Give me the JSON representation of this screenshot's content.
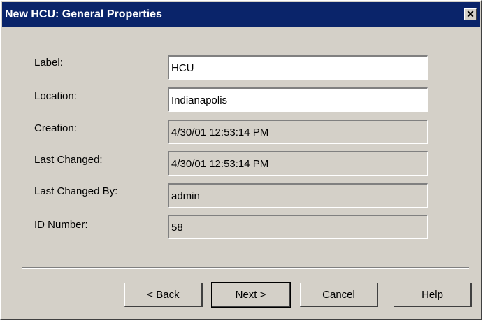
{
  "window": {
    "title": "New HCU: General Properties",
    "close_glyph": "✕"
  },
  "fields": [
    {
      "label": "Label:",
      "value": "HCU",
      "editable": true
    },
    {
      "label": "Location:",
      "value": "Indianapolis",
      "editable": true
    },
    {
      "label": "Creation:",
      "value": "4/30/01 12:53:14 PM",
      "editable": false
    },
    {
      "label": "Last Changed:",
      "value": "4/30/01 12:53:14 PM",
      "editable": false
    },
    {
      "label": "Last Changed By:",
      "value": "admin",
      "editable": false
    },
    {
      "label": "ID Number:",
      "value": "58",
      "editable": false
    }
  ],
  "buttons": {
    "back": "< Back",
    "next": "Next >",
    "cancel": "Cancel",
    "help": "Help"
  },
  "colors": {
    "titlebar": "#0a246a",
    "face": "#d4d0c8"
  }
}
